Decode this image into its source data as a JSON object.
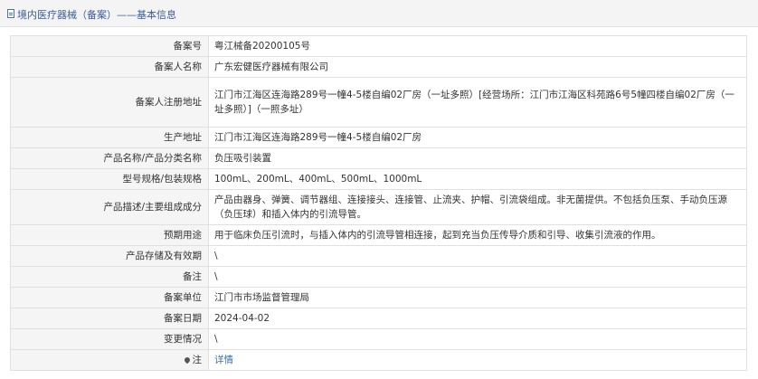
{
  "header": {
    "title": "境内医疗器械（备案）——基本信息"
  },
  "rows": [
    {
      "label": "备案号",
      "value": "粤江械备20200105号"
    },
    {
      "label": "备案人名称",
      "value": "广东宏健医疗器械有限公司"
    },
    {
      "label": "备案人注册地址",
      "value": "江门市江海区连海路289号一幢4-5楼自编02厂房（一址多照）[经营场所：江门市江海区科苑路6号5幢四楼自编02厂房（一址多照）]（一照多址）"
    },
    {
      "label": "生产地址",
      "value": "江门市江海区连海路289号一幢4-5楼自编02厂房"
    },
    {
      "label": "产品名称/产品分类名称",
      "value": "负压吸引装置"
    },
    {
      "label": "型号规格/包装规格",
      "value": "100mL、200mL、400mL、500mL、1000mL"
    },
    {
      "label": "产品描述/主要组成成分",
      "value": "产品由器身、弹簧、调节器组、连接接头、连接管、止流夹、护帽、引流袋组成。非无菌提供。不包括负压泵、手动负压源（负压球）和插入体内的引流导管。"
    },
    {
      "label": "预期用途",
      "value": "用于临床负压引流时，与插入体内的引流导管相连接，起到充当负压传导介质和引导、收集引流液的作用。"
    },
    {
      "label": "产品存储及有效期",
      "value": "\\"
    },
    {
      "label": "备注",
      "value": "\\"
    },
    {
      "label": "备案单位",
      "value": "江门市市场监督管理局"
    },
    {
      "label": "备案日期",
      "value": "2024-04-02"
    },
    {
      "label": "变更情况",
      "value": "\\"
    }
  ],
  "note": {
    "label": "注",
    "link": "详情",
    "icon": "pin-icon"
  }
}
